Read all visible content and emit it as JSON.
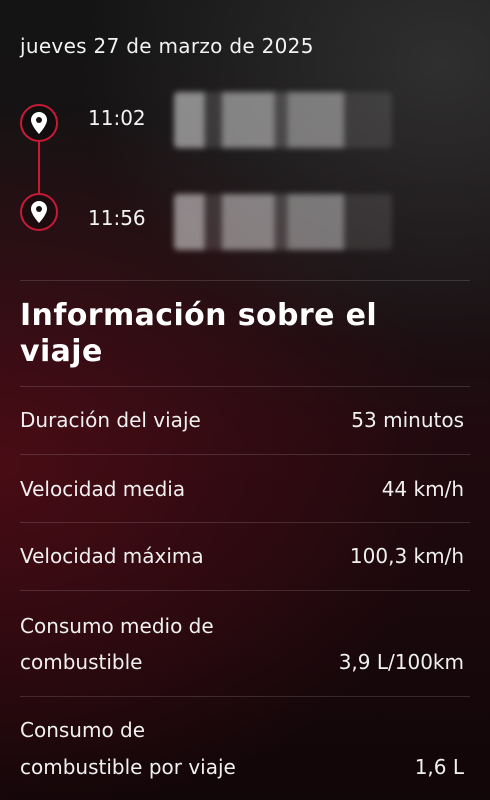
{
  "trip": {
    "date": "jueves 27 de marzo de 2025",
    "origin": {
      "time": "11:02",
      "icon": "location-pin-icon"
    },
    "destination": {
      "time": "11:56",
      "icon": "location-pin-icon"
    }
  },
  "info": {
    "title": "Información sobre el viaje",
    "rows": [
      {
        "label": "Duración del viaje",
        "value": "53 minutos"
      },
      {
        "label": "Velocidad media",
        "value": "44 km/h"
      },
      {
        "label": "Velocidad máxima",
        "value": "100,3 km/h"
      },
      {
        "label_line1": "Consumo medio de",
        "label_line2": "combustible",
        "value": "3,9 L/100km"
      },
      {
        "label_line1": "Consumo de",
        "label_line2": "combustible por viaje",
        "value": "1,6 L"
      }
    ]
  },
  "colors": {
    "accent": "#c61a35"
  }
}
